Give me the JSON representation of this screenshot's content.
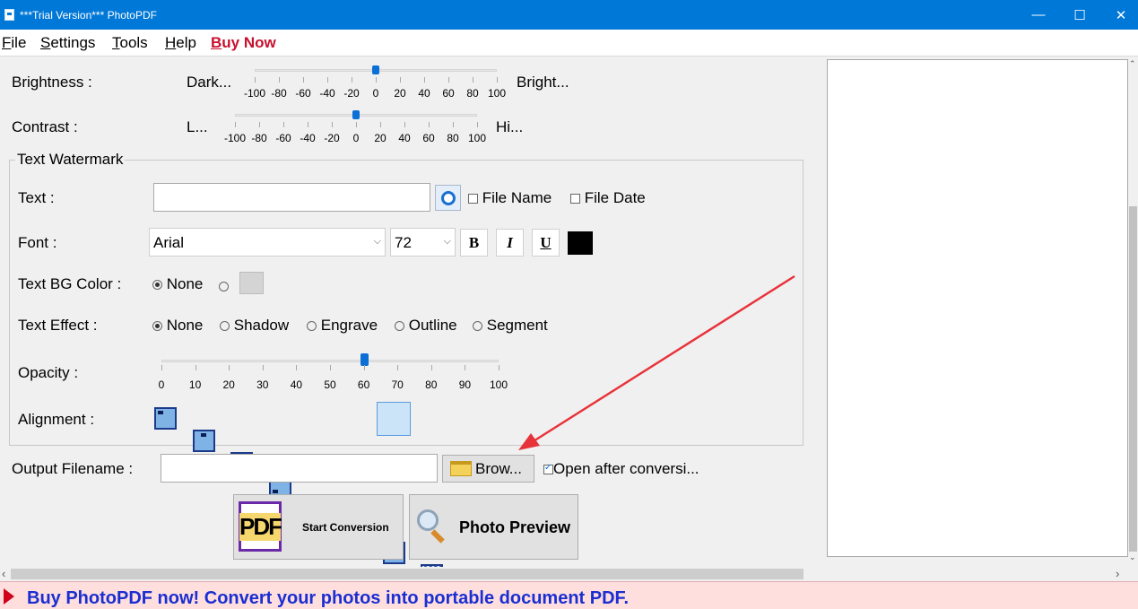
{
  "window": {
    "title": "***Trial Version*** PhotoPDF"
  },
  "menu": {
    "file_key": "F",
    "file_rest": "ile",
    "settings_key": "S",
    "settings_rest": "ettings",
    "tools_key": "T",
    "tools_rest": "ools",
    "help_key": "H",
    "help_rest": "elp",
    "buy_key": "B",
    "buy_rest": "uy Now"
  },
  "brightness": {
    "label": "Brightness :",
    "low": "Dark...",
    "high": "Bright...",
    "ticks": [
      "-100",
      "-80",
      "-60",
      "-40",
      "-20",
      "0",
      "20",
      "40",
      "60",
      "80",
      "100"
    ],
    "value": 0
  },
  "contrast": {
    "label": "Contrast :",
    "low": "L...",
    "high": "Hi...",
    "ticks": [
      "-100",
      "-80",
      "-60",
      "-40",
      "-20",
      "0",
      "20",
      "40",
      "60",
      "80",
      "100"
    ],
    "value": 0
  },
  "watermark": {
    "group_label": "Text Watermark",
    "text_label": "Text :",
    "text_value": "",
    "file_name_label": "File Name",
    "file_name_checked": false,
    "file_date_label": "File Date",
    "file_date_checked": false,
    "font_label": "Font :",
    "font_value": "Arial",
    "size_value": "72",
    "bold_glyph": "B",
    "italic_glyph": "I",
    "underline_glyph": "U",
    "font_color": "#000000",
    "bg_label": "Text BG Color :",
    "bg_none_label": "None",
    "bg_swatch": "#d4d4d4",
    "effect_label": "Text Effect  :",
    "effects": [
      "None",
      "Shadow",
      "Engrave",
      "Outline",
      "Segment"
    ],
    "effect_selected": "None",
    "opacity_label": "Opacity :",
    "opacity_ticks": [
      "0",
      "10",
      "20",
      "30",
      "40",
      "50",
      "60",
      "70",
      "80",
      "90",
      "100"
    ],
    "opacity_value": 60,
    "alignment_label": "Alignment :",
    "alignment_selected": 7
  },
  "output": {
    "label": "Output Filename :",
    "value": "",
    "browse_label": "Brow...",
    "open_after_label": "Open after conversi...",
    "open_after_checked": true
  },
  "actions": {
    "start_icon_text": "PDF",
    "start_label": "Start Conversion",
    "preview_label": "Photo Preview"
  },
  "banner": {
    "text": "Buy PhotoPDF now! Convert your photos into portable document PDF."
  },
  "colors": {
    "titlebar": "#0078d7",
    "accent": "#0a6fd6",
    "buy_now": "#c8102e",
    "banner_text": "#1a2fd1",
    "annotation_arrow": "#e8323a"
  }
}
